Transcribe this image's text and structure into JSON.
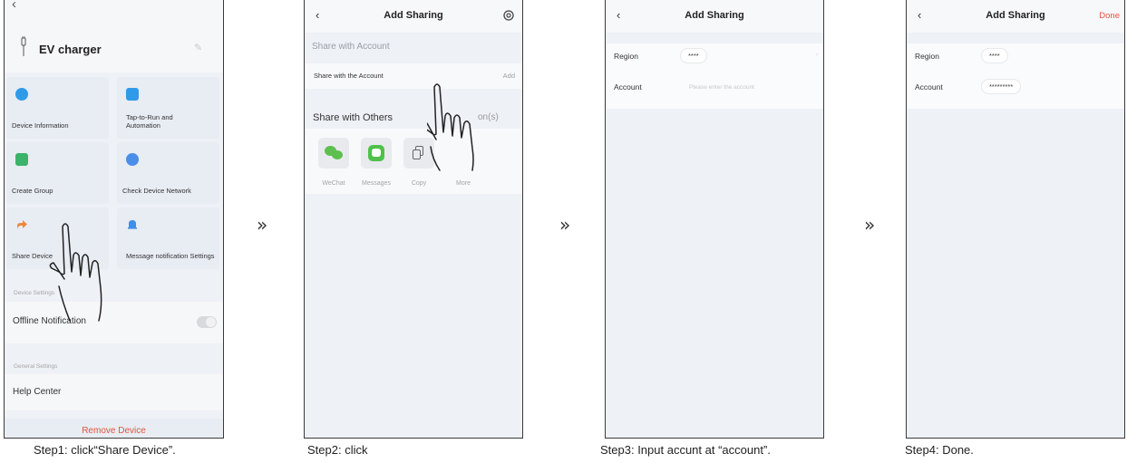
{
  "steps": {
    "arrow": "»",
    "captions": [
      "Step1: click“Share Device”.",
      "Step2: click",
      "Step3: Input accunt at “account”.",
      "Step4: Done."
    ]
  },
  "screen1": {
    "title": "EV charger",
    "tiles": [
      {
        "label": "Device Information",
        "icon": "info-icon",
        "color": "#2f9be8"
      },
      {
        "label": "Tap-to-Run and Automation",
        "icon": "check-shield-icon",
        "color": "#2f9be8"
      },
      {
        "label": "Create Group",
        "icon": "group-icon",
        "color": "#3bb36a"
      },
      {
        "label": "Check Device Network",
        "icon": "network-icon",
        "color": "#4a8ee8"
      },
      {
        "label": "Share Device",
        "icon": "share-icon",
        "color": "#f0883a"
      },
      {
        "label": "Message notification Settings",
        "icon": "bell-icon",
        "color": "#3d8fe8"
      }
    ],
    "device_settings": "Device Settings",
    "offline_notification": "Offline Notification",
    "general_settings": "General Settings",
    "help_center": "Help Center",
    "remove_device": "Remove Device"
  },
  "screen2": {
    "title": "Add Sharing",
    "section_account": "Share with Account",
    "row_label": "Share with the Account",
    "row_action": "Add",
    "section_others": "Share with Others",
    "section_others_right": "on(s)",
    "share_targets": [
      "WeChat",
      "Messages",
      "Copy",
      "More"
    ]
  },
  "screen3": {
    "title": "Add Sharing",
    "region_label": "Region",
    "region_value": "****",
    "account_label": "Account",
    "account_placeholder": "Please enter the account"
  },
  "screen4": {
    "title": "Add Sharing",
    "done": "Done",
    "region_label": "Region",
    "region_value": "****",
    "account_label": "Account",
    "account_value": "*********"
  }
}
